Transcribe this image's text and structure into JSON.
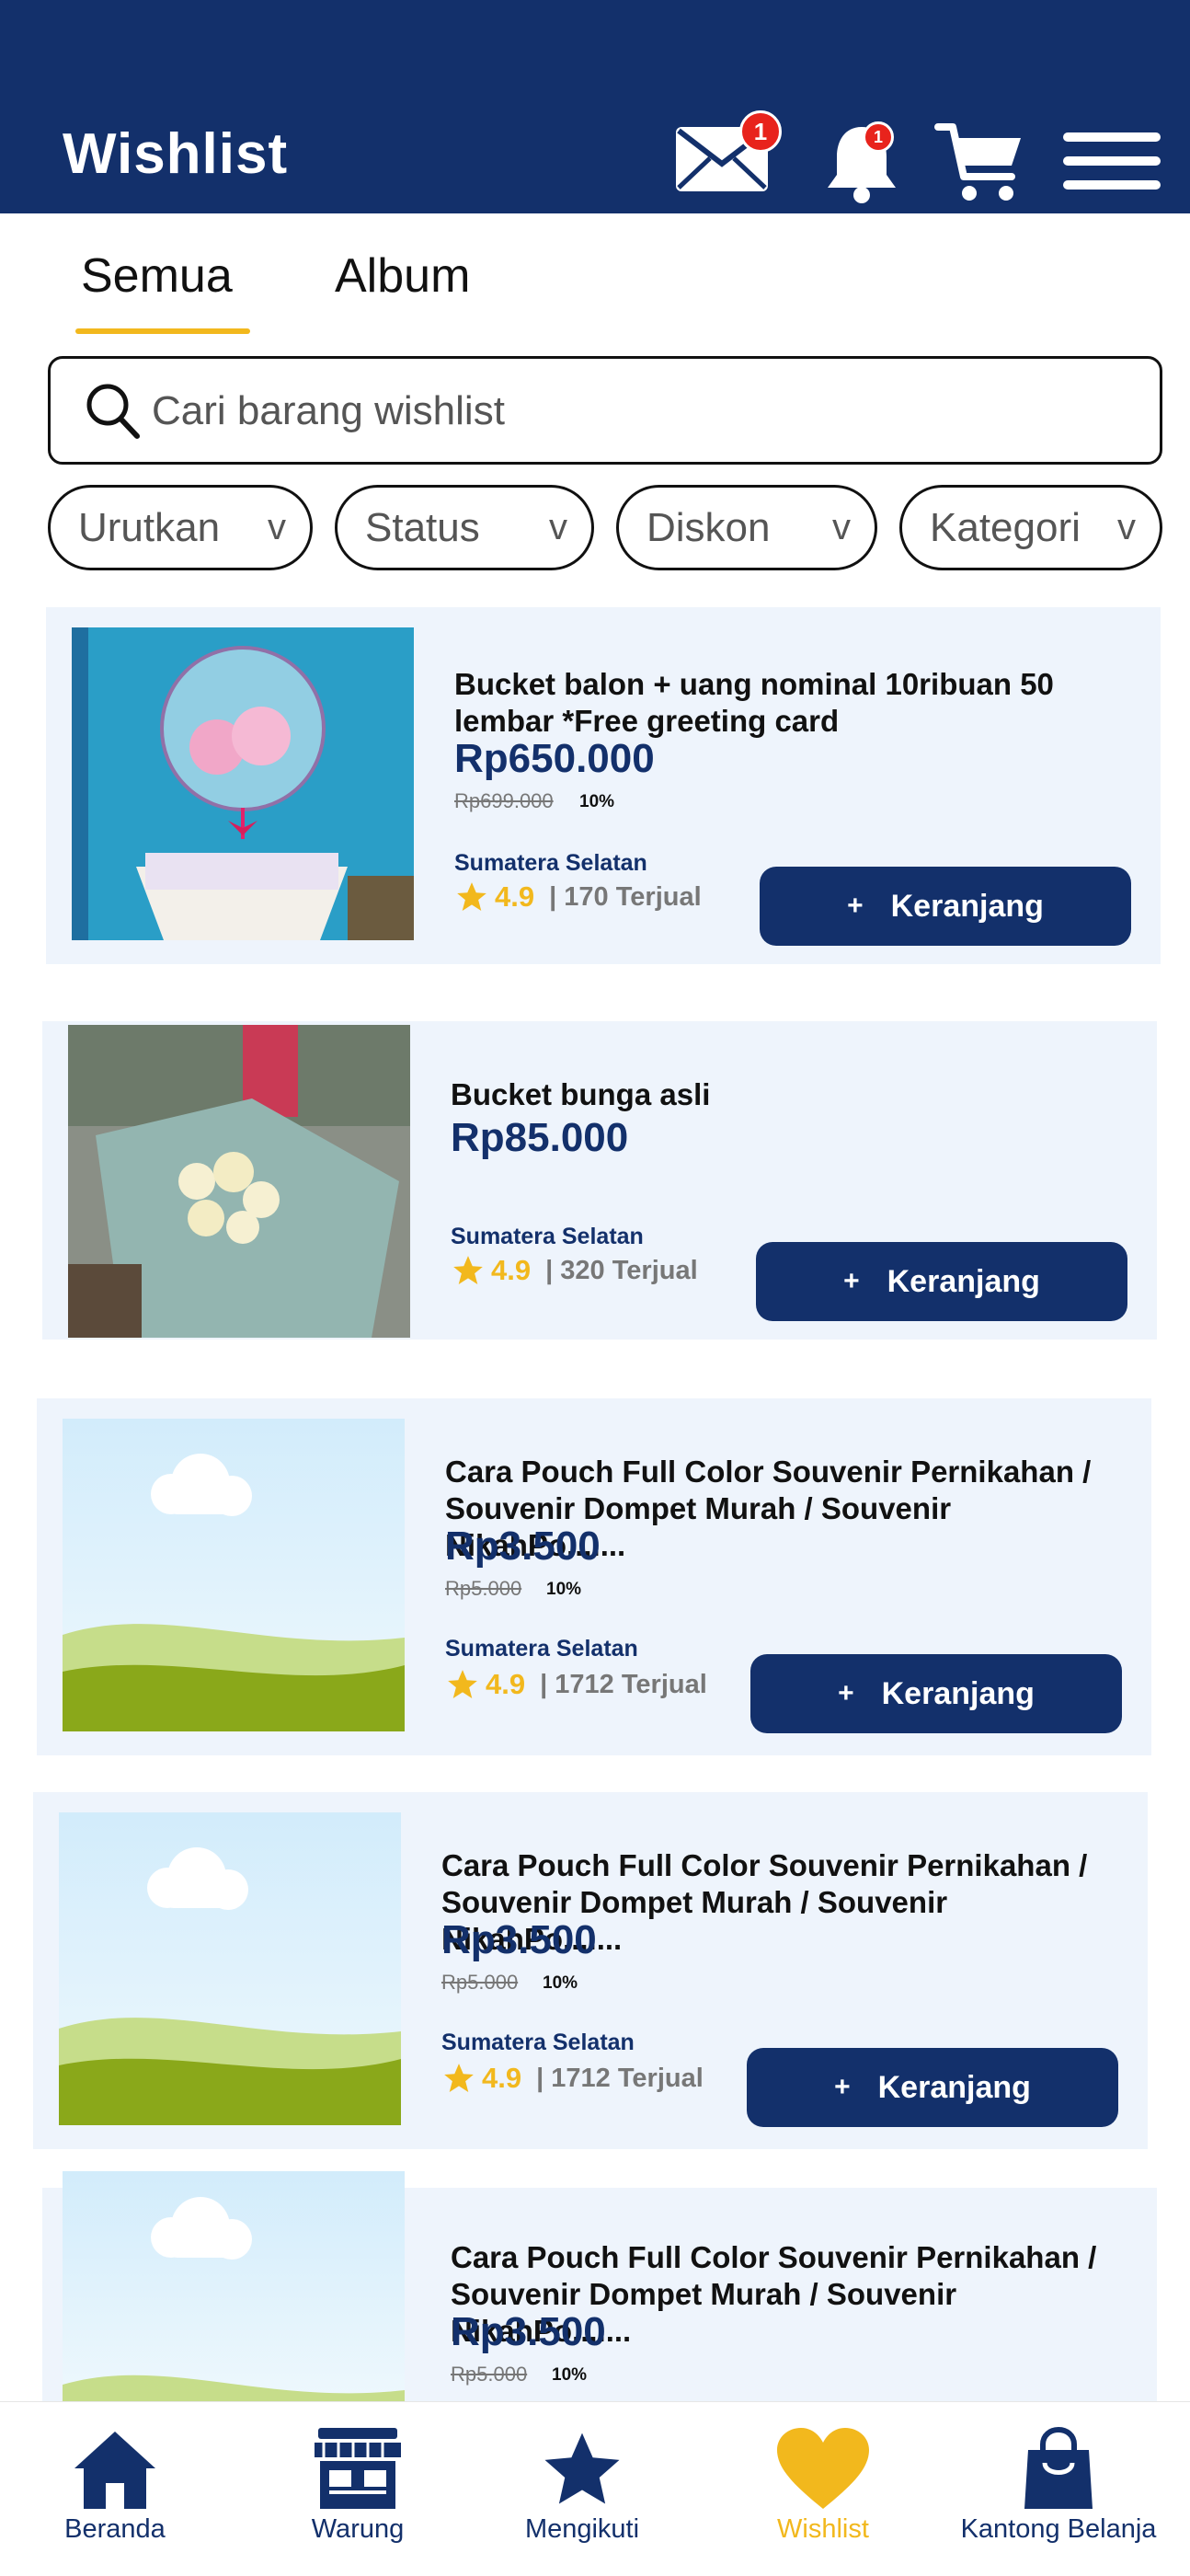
{
  "header": {
    "title": "Wishlist",
    "mail_badge": "1",
    "notif_badge": "1",
    "bg_color": "#13306b",
    "accent_color": "#f2b81d",
    "badge_color": "#e8231c"
  },
  "tabs": [
    {
      "label": "Semua",
      "active": true
    },
    {
      "label": "Album",
      "active": false
    }
  ],
  "search": {
    "placeholder": "Cari barang wishlist",
    "value": ""
  },
  "filters": [
    {
      "label": "Urutkan",
      "chevron": "v"
    },
    {
      "label": "Status",
      "chevron": "v"
    },
    {
      "label": "Diskon",
      "chevron": "v"
    },
    {
      "label": "Kategori",
      "chevron": "v"
    }
  ],
  "products": [
    {
      "name": "Bucket balon + uang nominal 10ribuan 50 lembar *Free greeting card",
      "price": "Rp650.000",
      "old_price": "Rp699.000",
      "discount": "10%",
      "location": "Sumatera Selatan",
      "rating": "4.9",
      "sold": "| 170 Terjual",
      "cart_label": "Keranjang",
      "image": "balloon-bucket-photo"
    },
    {
      "name": "Bucket bunga asli",
      "price": "Rp85.000",
      "old_price": "",
      "discount": "",
      "location": "Sumatera Selatan",
      "rating": "4.9",
      "sold": "| 320 Terjual",
      "cart_label": "Keranjang",
      "image": "flower-bucket-photo"
    },
    {
      "name": "Cara Pouch Full Color Souvenir Pernikahan / Souvenir Dompet Murah / Souvenir NikahPo.......",
      "price": "Rp3.500",
      "old_price": "Rp5.000",
      "discount": "10%",
      "location": "Sumatera Selatan",
      "rating": "4.9",
      "sold": "| 1712 Terjual",
      "cart_label": "Keranjang",
      "image": "placeholder-landscape"
    },
    {
      "name": "Cara Pouch Full Color Souvenir Pernikahan / Souvenir Dompet Murah / Souvenir NikahPo.......",
      "price": "Rp3.500",
      "old_price": "Rp5.000",
      "discount": "10%",
      "location": "Sumatera Selatan",
      "rating": "4.9",
      "sold": "| 1712 Terjual",
      "cart_label": "Keranjang",
      "image": "placeholder-landscape"
    },
    {
      "name": "Cara Pouch Full Color Souvenir Pernikahan / Souvenir Dompet Murah / Souvenir NikahPo.......",
      "price": "Rp3.500",
      "old_price": "Rp5.000",
      "discount": "10%",
      "image": "placeholder-landscape"
    }
  ],
  "cart_plus": "+",
  "bottom_nav": [
    {
      "label": "Beranda",
      "icon": "home-icon",
      "active": false
    },
    {
      "label": "Warung",
      "icon": "store-icon",
      "active": false
    },
    {
      "label": "Mengikuti",
      "icon": "star-icon",
      "active": false
    },
    {
      "label": "Wishlist",
      "icon": "heart-icon",
      "active": true
    },
    {
      "label": "Kantong Belanja",
      "icon": "shopping-bag-icon",
      "active": false
    }
  ]
}
